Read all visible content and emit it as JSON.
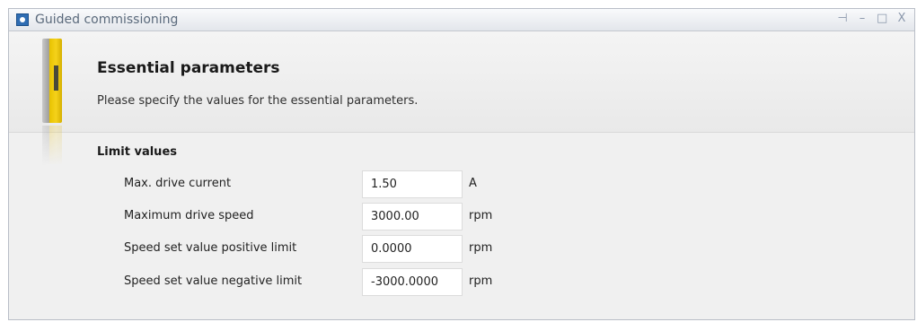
{
  "window": {
    "title": "Guided commissioning",
    "icon": "commissioning-icon",
    "buttons": {
      "pin": "⊣",
      "minimize": "–",
      "maximize": "□",
      "close": "X"
    }
  },
  "header": {
    "title": "Essential parameters",
    "subtitle": "Please specify the values for the essential parameters.",
    "image": "drive-device-icon"
  },
  "section": {
    "title": "Limit values",
    "params": [
      {
        "label": "Max. drive current",
        "value": "1.50",
        "unit": "A"
      },
      {
        "label": "Maximum drive speed",
        "value": "3000.00",
        "unit": "rpm"
      },
      {
        "label": "Speed set value positive limit",
        "value": "0.0000",
        "unit": "rpm"
      },
      {
        "label": "Speed set value negative limit",
        "value": "-3000.0000",
        "unit": "rpm"
      }
    ]
  }
}
